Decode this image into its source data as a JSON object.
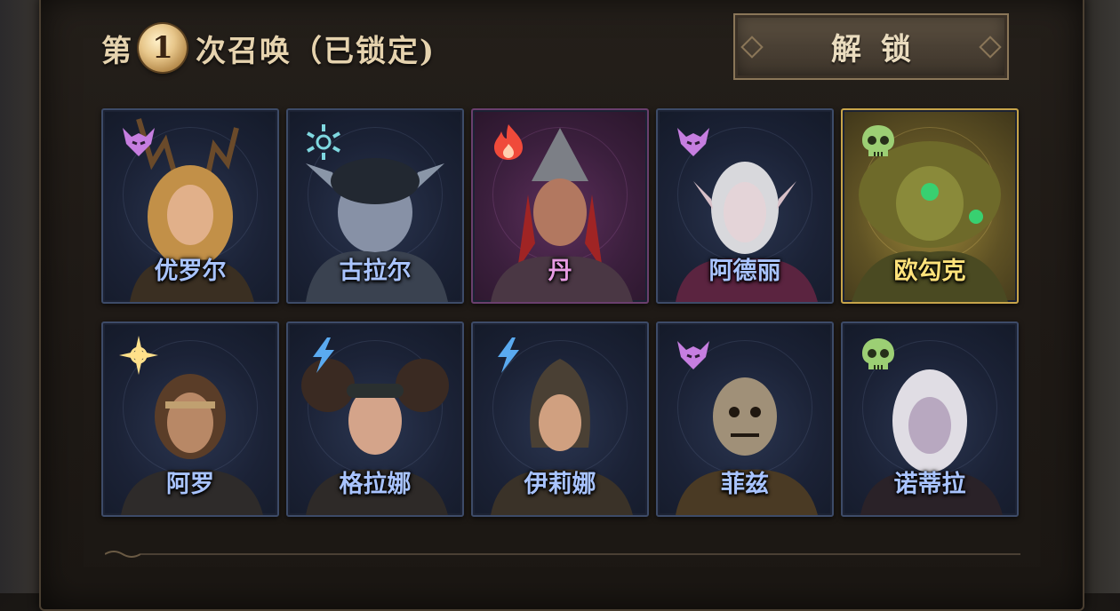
{
  "header": {
    "prefix": "第",
    "summon_number": "1",
    "suffix": "次召唤（已锁定)",
    "unlock_label": "解锁"
  },
  "colors": {
    "common_name": "#a9c4ff",
    "epic_name": "#e79be3",
    "legendary_name": "#ffe27a",
    "demon_icon": "#c67ee0",
    "frost_icon": "#7fd8e0",
    "fire_icon": "#f04a3a",
    "skull_icon": "#9ccf74",
    "light_icon": "#ffe08a",
    "lightning_icon": "#5aaaf0"
  },
  "heroes": [
    {
      "name": "优罗尔",
      "element": "demon-icon",
      "rarity": "rare"
    },
    {
      "name": "古拉尔",
      "element": "frost-icon",
      "rarity": "rare"
    },
    {
      "name": "丹",
      "element": "fire-icon",
      "rarity": "epic"
    },
    {
      "name": "阿德丽",
      "element": "demon-icon",
      "rarity": "rare"
    },
    {
      "name": "欧勾克",
      "element": "skull-icon",
      "rarity": "legendary"
    },
    {
      "name": "阿罗",
      "element": "light-icon",
      "rarity": "rare"
    },
    {
      "name": "格拉娜",
      "element": "lightning-icon",
      "rarity": "rare"
    },
    {
      "name": "伊莉娜",
      "element": "lightning-icon",
      "rarity": "rare"
    },
    {
      "name": "菲兹",
      "element": "demon-icon",
      "rarity": "rare"
    },
    {
      "name": "诺蒂拉",
      "element": "skull-icon",
      "rarity": "rare"
    }
  ]
}
